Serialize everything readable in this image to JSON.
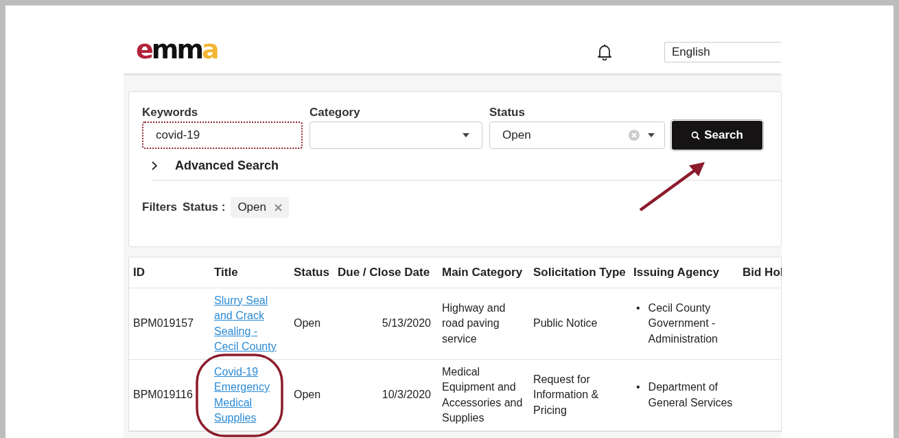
{
  "header": {
    "logo_text": "emma",
    "language": "English"
  },
  "search": {
    "keywords": {
      "label": "Keywords",
      "value": "covid-19",
      "focused": true
    },
    "category": {
      "label": "Category"
    },
    "status": {
      "label": "Status",
      "value": "Open"
    },
    "button": "Search",
    "advanced": {
      "label": "Advanced Search",
      "expanded": false
    },
    "filters": {
      "label": "Filters",
      "chips": [
        {
          "name": "Status :",
          "value": "Open"
        }
      ]
    }
  },
  "table": {
    "columns": [
      "ID",
      "Title",
      "Status",
      "Due / Close Date",
      "Main Category",
      "Solicitation Type",
      "Issuing Agency",
      "Bid Hol"
    ],
    "rows": [
      {
        "id": "BPM019157",
        "title": "Slurry Seal and Crack Sealing - Cecil County",
        "status": "Open",
        "due": "5/13/2020",
        "category": "Highway and road paving service",
        "type": "Public Notice",
        "agency_bullet": "•",
        "agency": "Cecil County Government - Administration",
        "highlighted": false
      },
      {
        "id": "BPM019116",
        "title": "Covid-19 Emergency Medical Supplies",
        "status": "Open",
        "due": "10/3/2020",
        "category": "Medical Equipment and Accessories and Supplies",
        "type": "Request for Information & Pricing",
        "agency_bullet": "•",
        "agency": "Department of General Services",
        "highlighted": true
      }
    ]
  },
  "annotations": {
    "arrow_to_search": true
  }
}
